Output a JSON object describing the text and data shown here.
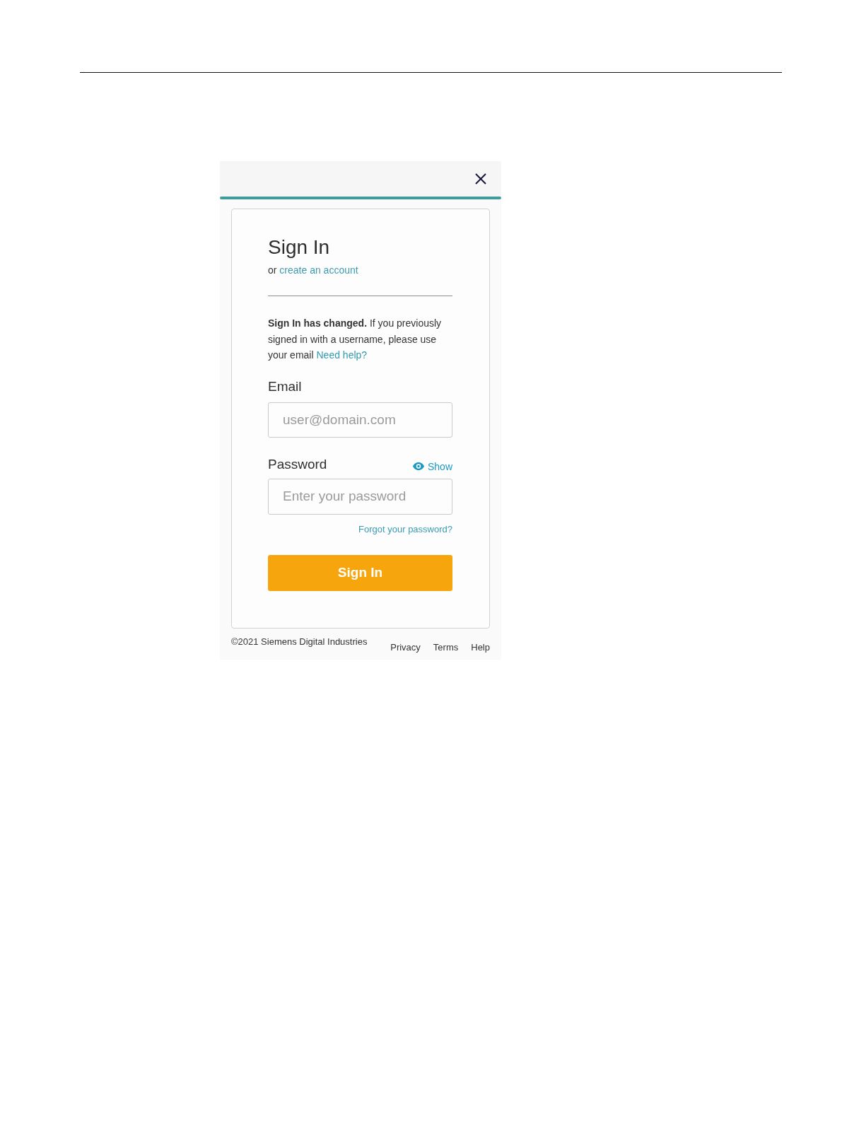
{
  "dialog": {
    "card": {
      "title": "Sign In",
      "subtitle": {
        "prefix": "or",
        "link": "create an account"
      },
      "notice": {
        "text": "**Sign In has changed.** If you previously signed in with a username, please use your email",
        "link": "Need help?"
      },
      "fields": [
        {
          "label": "Email",
          "placeholder": "user@domain.com"
        },
        {
          "label": "Password",
          "placeholder": "Enter your password",
          "toggle": "Show"
        }
      ],
      "forgot_link": "Forgot your password?",
      "submit": "Sign In"
    },
    "footer": {
      "copyright": "©2021 Siemens Digital Industries",
      "links": [
        "Privacy",
        "Terms",
        "Help"
      ]
    }
  }
}
